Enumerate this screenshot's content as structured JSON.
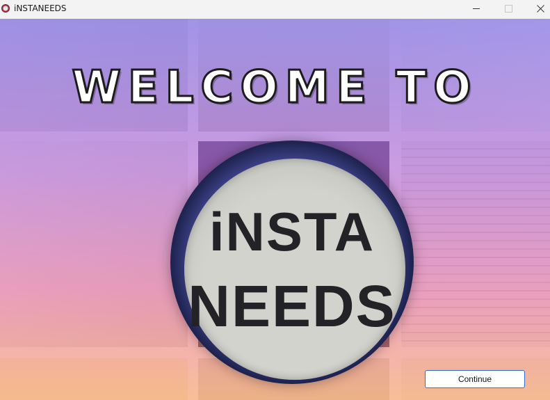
{
  "window": {
    "title": "iNSTANEEDS"
  },
  "hero": {
    "heading": "WELCOME TO",
    "logo_line1": "iNSTA",
    "logo_line2": "NEEDS"
  },
  "actions": {
    "continue_label": "Continue"
  },
  "colors": {
    "gradient_top": "#8070e2",
    "gradient_mid": "#b268d6",
    "gradient_bottom": "#f8a060",
    "button_border": "#2f6fd6"
  },
  "icons": [
    "app-icon",
    "minimize-icon",
    "maximize-icon",
    "close-icon"
  ]
}
